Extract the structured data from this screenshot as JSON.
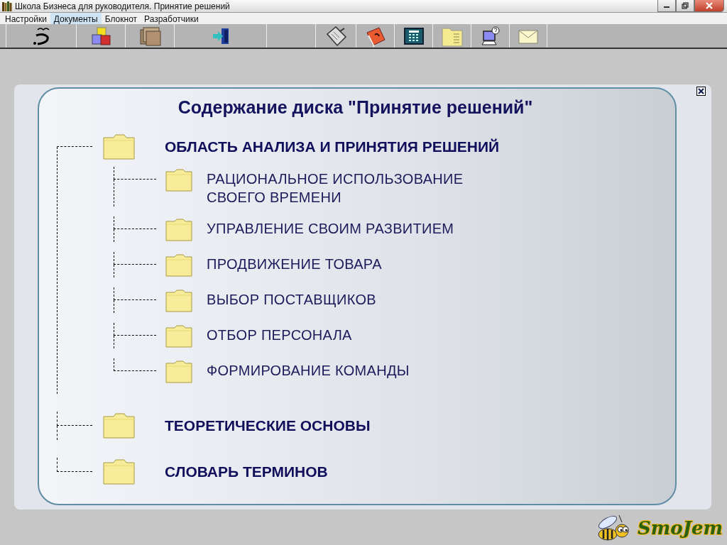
{
  "window": {
    "title": "Школа Бизнеса для руководителя. Принятие решений"
  },
  "menu": [
    {
      "label": "Настройки",
      "selected": false
    },
    {
      "label": "Документы",
      "selected": true
    },
    {
      "label": "Блокнот",
      "selected": false
    },
    {
      "label": "Разработчики",
      "selected": false
    }
  ],
  "content": {
    "title": "Содержание диска \"Принятие решений\"",
    "tree": [
      {
        "label": "ОБЛАСТЬ АНАЛИЗА И ПРИНЯТИЯ РЕШЕНИЙ",
        "children": [
          {
            "label": "РАЦИОНАЛЬНОЕ ИСПОЛЬЗОВАНИЕ СВОЕГО ВРЕМЕНИ"
          },
          {
            "label": "УПРАВЛЕНИЕ СВОИМ РАЗВИТИЕМ"
          },
          {
            "label": "ПРОДВИЖЕНИЕ ТОВАРА"
          },
          {
            "label": "ВЫБОР ПОСТАВЩИКОВ"
          },
          {
            "label": "ОТБОР ПЕРСОНАЛА"
          },
          {
            "label": "ФОРМИРОВАНИЕ КОМАНДЫ"
          }
        ]
      },
      {
        "label": "ТЕОРЕТИЧЕСКИЕ ОСНОВЫ"
      },
      {
        "label": "СЛОВАРЬ ТЕРМИНОВ"
      }
    ]
  },
  "logo": {
    "text": "SmoJem"
  }
}
